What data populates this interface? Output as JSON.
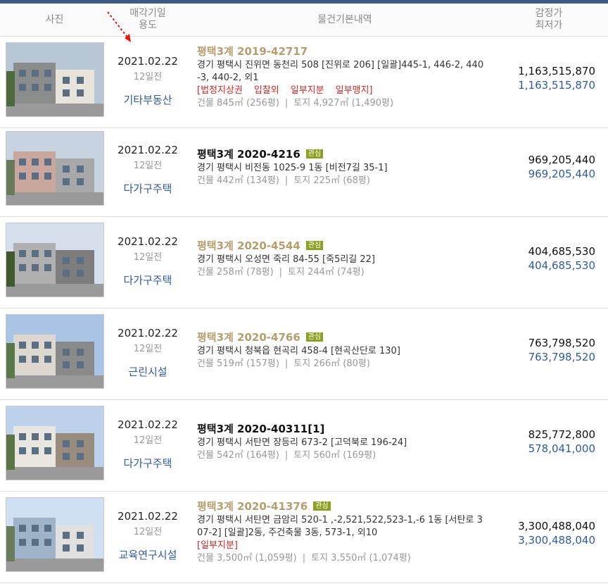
{
  "header": {
    "photo": "사진",
    "date_line1": "매각기일",
    "date_line2": "용도",
    "info": "물건기본내역",
    "price_line1": "감정가",
    "price_line2": "최저가"
  },
  "colors": {
    "accent_blue": "#2c5aa8",
    "case_gold": "#b59d6c",
    "tag_green": "#8aa21f",
    "red": "#d22222"
  },
  "rows": [
    {
      "date": "2021.02.22",
      "ago": "12일전",
      "use": "기타부동산",
      "case": "평택3계 2019-42717",
      "tag": "",
      "addr1": "경기 평택시 진위면 동천리 508 [진위로 206]  [일괄]445-1, 446-2, 440",
      "addr2": "-3, 440-2, 외1",
      "notes": [
        "[법정지상권",
        "입찰외",
        "일부지분",
        "일부맹지]"
      ],
      "area_building": "건물 845㎡ (256평)",
      "area_land": "토지 4,927㎡ (1,490평)",
      "appraisal": "1,163,515,870",
      "minimum": "1,163,515,870",
      "photo_icon": "building-photo"
    },
    {
      "date": "2021.02.22",
      "ago": "12일전",
      "use": "다가구주택",
      "case": "평택3계 2020-4216",
      "tag": "관심",
      "addr1": "경기 평택시 비전동 1025-9 1동 [비전7길 35-1]",
      "addr2": "",
      "notes": [],
      "area_building": "건물 442㎡ (134평)",
      "area_land": "토지 225㎡ (68평)",
      "appraisal": "969,205,440",
      "minimum": "969,205,440",
      "photo_icon": "building-photo"
    },
    {
      "date": "2021.02.22",
      "ago": "12일전",
      "use": "다가구주택",
      "case": "평택3계 2020-4544",
      "tag": "관심",
      "addr1": "경기 평택시 오성면 죽리 84-55 [죽5리길 22]",
      "addr2": "",
      "notes": [],
      "area_building": "건물 258㎡ (78평)",
      "area_land": "토지 244㎡ (74평)",
      "appraisal": "404,685,530",
      "minimum": "404,685,530",
      "photo_icon": "building-photo"
    },
    {
      "date": "2021.02.22",
      "ago": "12일전",
      "use": "근린시설",
      "case": "평택3계 2020-4766",
      "tag": "관심",
      "addr1": "경기 평택시 청북읍 현곡리 458-4 [현곡산단로 130]",
      "addr2": "",
      "notes": [],
      "area_building": "건물 519㎡ (157평)",
      "area_land": "토지 266㎡ (80평)",
      "appraisal": "763,798,520",
      "minimum": "763,798,520",
      "photo_icon": "building-photo"
    },
    {
      "date": "2021.02.22",
      "ago": "12일전",
      "use": "다가구주택",
      "case": "평택3계 2020-40311[1]",
      "tag": "",
      "addr1": "경기 평택시 서탄면 장등리 673-2 [고덕북로 196-24]",
      "addr2": "",
      "notes": [],
      "area_building": "건물 542㎡ (164평)",
      "area_land": "토지 560㎡ (169평)",
      "appraisal": "825,772,800",
      "minimum": "578,041,000",
      "photo_icon": "building-photo"
    },
    {
      "date": "2021.02.22",
      "ago": "12일전",
      "use": "교육연구시설",
      "case": "평택3계 2020-41376",
      "tag": "관심",
      "addr1": "경기 평택시 서탄면 금암리 520-1 ,-2,521,522,523-1,-6 1동 [서탄로 3",
      "addr2": "07-2]  [일괄]2동, 주건축물 3동, 573-1, 외10",
      "notes": [
        "[일부지분]"
      ],
      "area_building": "건물 3,500㎡ (1,059평)",
      "area_land": "토지 3,550㎡ (1,074평)",
      "appraisal": "3,300,488,040",
      "minimum": "3,300,488,040",
      "photo_icon": "building-photo"
    }
  ]
}
